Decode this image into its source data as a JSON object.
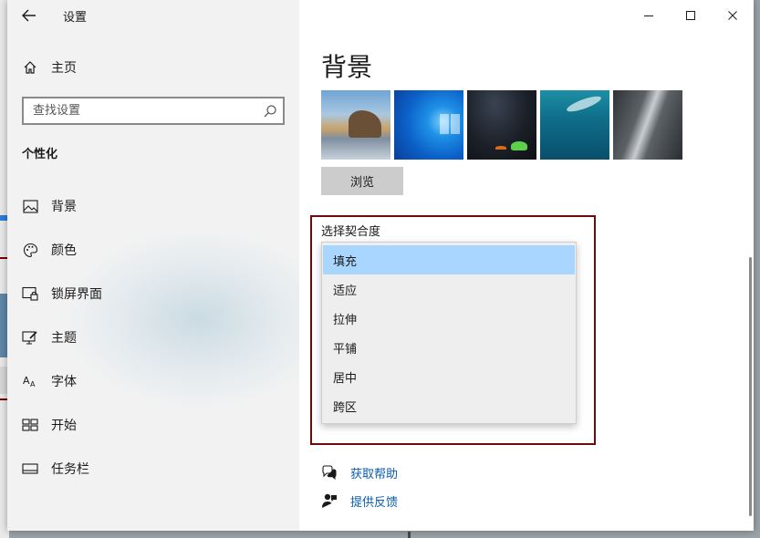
{
  "window": {
    "title": "设置",
    "controls": {
      "minimize": "—",
      "maximize": "☐",
      "close": "✕"
    }
  },
  "sidebar": {
    "home": "主页",
    "search_placeholder": "查找设置",
    "section": "个性化",
    "items": [
      {
        "label": "背景",
        "icon": "picture-icon"
      },
      {
        "label": "颜色",
        "icon": "palette-icon"
      },
      {
        "label": "锁屏界面",
        "icon": "lock-screen-icon"
      },
      {
        "label": "主题",
        "icon": "theme-icon"
      },
      {
        "label": "字体",
        "icon": "font-icon"
      },
      {
        "label": "开始",
        "icon": "start-icon"
      },
      {
        "label": "任务栏",
        "icon": "taskbar-icon"
      }
    ]
  },
  "main": {
    "title": "背景",
    "browse_label": "浏览",
    "fit_label": "选择契合度",
    "fit_options": [
      "填充",
      "适应",
      "拉伸",
      "平铺",
      "居中",
      "跨区"
    ],
    "fit_selected": "填充",
    "links": [
      {
        "label": "获取帮助",
        "icon": "help-chat-icon"
      },
      {
        "label": "提供反馈",
        "icon": "feedback-icon"
      }
    ]
  },
  "colors": {
    "accent_link": "#0b5cab",
    "selected_option": "#a9d6ff",
    "highlight_box": "#6e0a0a"
  }
}
